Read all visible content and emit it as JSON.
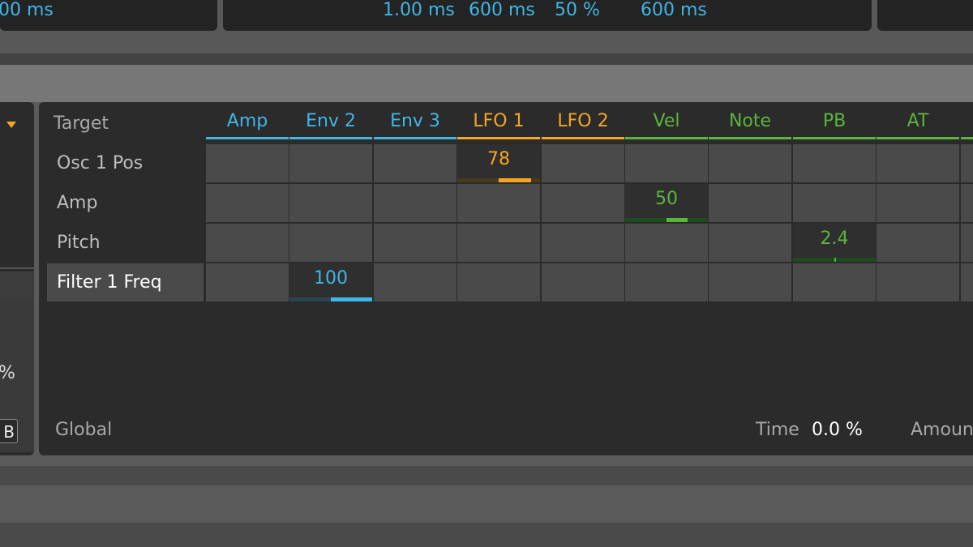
{
  "top_values": [
    "00 ms",
    "1.00 ms",
    "600 ms",
    "50 %",
    "600 ms"
  ],
  "left": {
    "percent_fragment": "%",
    "button_fragment": "B"
  },
  "matrix": {
    "target_label": "Target",
    "columns": [
      {
        "label": "Amp",
        "color": "#3fb6e6"
      },
      {
        "label": "Env 2",
        "color": "#3fb6e6"
      },
      {
        "label": "Env 3",
        "color": "#3fb6e6"
      },
      {
        "label": "LFO 1",
        "color": "#f5a623"
      },
      {
        "label": "LFO 2",
        "color": "#f5a623"
      },
      {
        "label": "Vel",
        "color": "#5bb53d"
      },
      {
        "label": "Note",
        "color": "#5bb53d"
      },
      {
        "label": "PB",
        "color": "#5bb53d"
      },
      {
        "label": "AT",
        "color": "#5bb53d"
      }
    ],
    "rows": [
      {
        "label": "Osc 1 Pos",
        "selected": false
      },
      {
        "label": "Amp",
        "selected": false
      },
      {
        "label": "Pitch",
        "selected": false
      },
      {
        "label": "Filter 1 Freq",
        "selected": true
      }
    ],
    "active_cells": [
      {
        "row": 0,
        "col": 3,
        "value": "78",
        "amount": 0.78,
        "color": "#f5a623",
        "track_color": "#4a3a1c"
      },
      {
        "row": 1,
        "col": 5,
        "value": "50",
        "amount": 0.5,
        "color": "#5bb53d",
        "track_color": "#1f4a1f"
      },
      {
        "row": 2,
        "col": 7,
        "value": "2.4",
        "amount": 0.024,
        "color": "#5bb53d",
        "track_color": "#1f4a1f"
      },
      {
        "row": 3,
        "col": 1,
        "value": "100",
        "amount": 1.0,
        "color": "#3fb6e6",
        "track_color": "#2a4550"
      }
    ]
  },
  "footer": {
    "global_label": "Global",
    "time_label": "Time",
    "time_value": "0.0 %",
    "amount_label": "Amoun"
  }
}
